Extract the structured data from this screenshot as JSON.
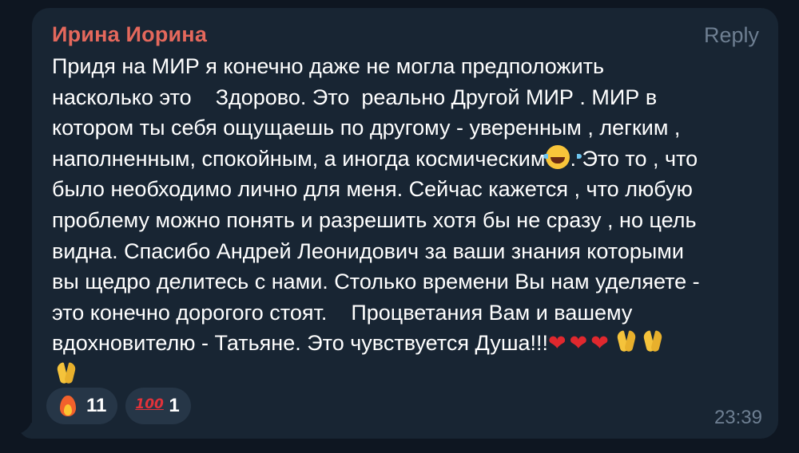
{
  "message": {
    "sender": "Ирина Иорина",
    "reply_label": "Reply",
    "lines": [
      "Придя на МИР я конечно даже не могла предположить",
      "насколько это    Здорово. Это  реально Другой МИР . МИР в",
      "котором ты себя ощущаешь по другому - уверенным , легким ,",
      "наполненным, спокойным, а иногда космическим",
      ". Это то , что",
      "было необходимо лично для меня. Сейчас кажется , что любую",
      "проблему можно понять и разрешить хотя бы не сразу , но цель",
      "видна. Спасибо Андрей Леонидович за ваши знания которыми",
      "вы щедро делитесь с нами. Столько времени Вы нам уделяете -",
      "это конечно дорогого стоят.    Процветания Вам и вашему",
      "вдохновителю - Татьяне. Это чувствуется Душа!!!"
    ],
    "emoji": {
      "laugh": "face-with-tears-of-joy-icon",
      "heart": "❤",
      "pray": "folded-hands-icon"
    },
    "time": "23:39"
  },
  "reactions": [
    {
      "icon": "fire-icon",
      "count": "11"
    },
    {
      "icon": "hundred-points-icon",
      "symbol": "100",
      "count": "1"
    }
  ],
  "colors": {
    "background": "#0e1621",
    "bubble": "#182533",
    "sender": "#e4685c",
    "muted": "#6e7f92",
    "reaction_bg": "#263647"
  }
}
